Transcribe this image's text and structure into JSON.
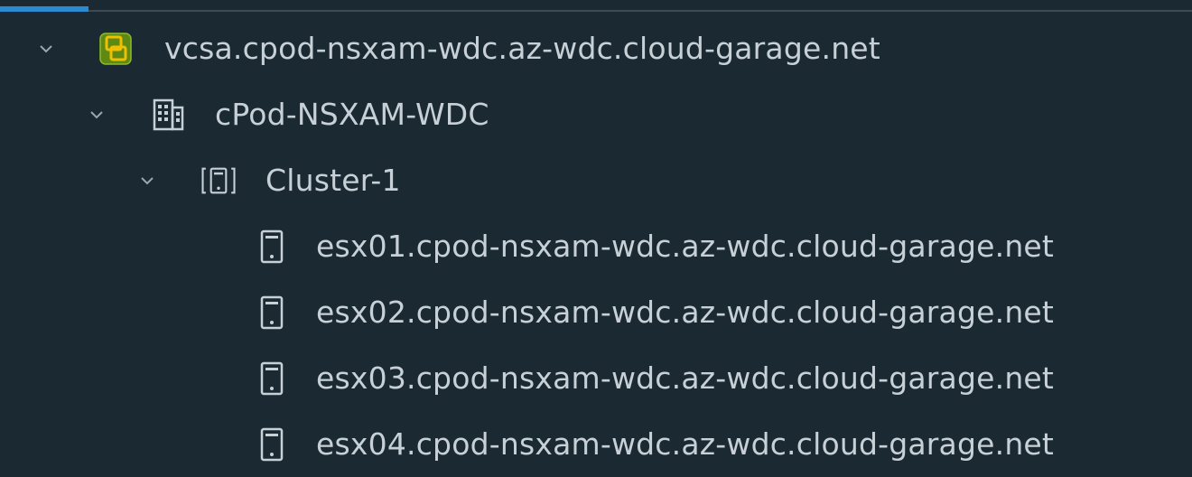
{
  "tree": {
    "vcenter": {
      "label": "vcsa.cpod-nsxam-wdc.az-wdc.cloud-garage.net",
      "icon": "vcenter-icon",
      "expanded": true
    },
    "datacenter": {
      "label": "cPod-NSXAM-WDC",
      "icon": "datacenter-icon",
      "expanded": true
    },
    "cluster": {
      "label": "Cluster-1",
      "icon": "cluster-icon",
      "expanded": true
    },
    "hosts": [
      {
        "label": "esx01.cpod-nsxam-wdc.az-wdc.cloud-garage.net",
        "icon": "host-icon"
      },
      {
        "label": "esx02.cpod-nsxam-wdc.az-wdc.cloud-garage.net",
        "icon": "host-icon"
      },
      {
        "label": "esx03.cpod-nsxam-wdc.az-wdc.cloud-garage.net",
        "icon": "host-icon"
      },
      {
        "label": "esx04.cpod-nsxam-wdc.az-wdc.cloud-garage.net",
        "icon": "host-icon"
      }
    ]
  },
  "colors": {
    "background": "#1b2a32",
    "text": "#c7d0d6",
    "accent": "#2a8bd2",
    "vcenter_icon_green": "#6f9a1e",
    "vcenter_icon_yellow": "#e8b400"
  }
}
